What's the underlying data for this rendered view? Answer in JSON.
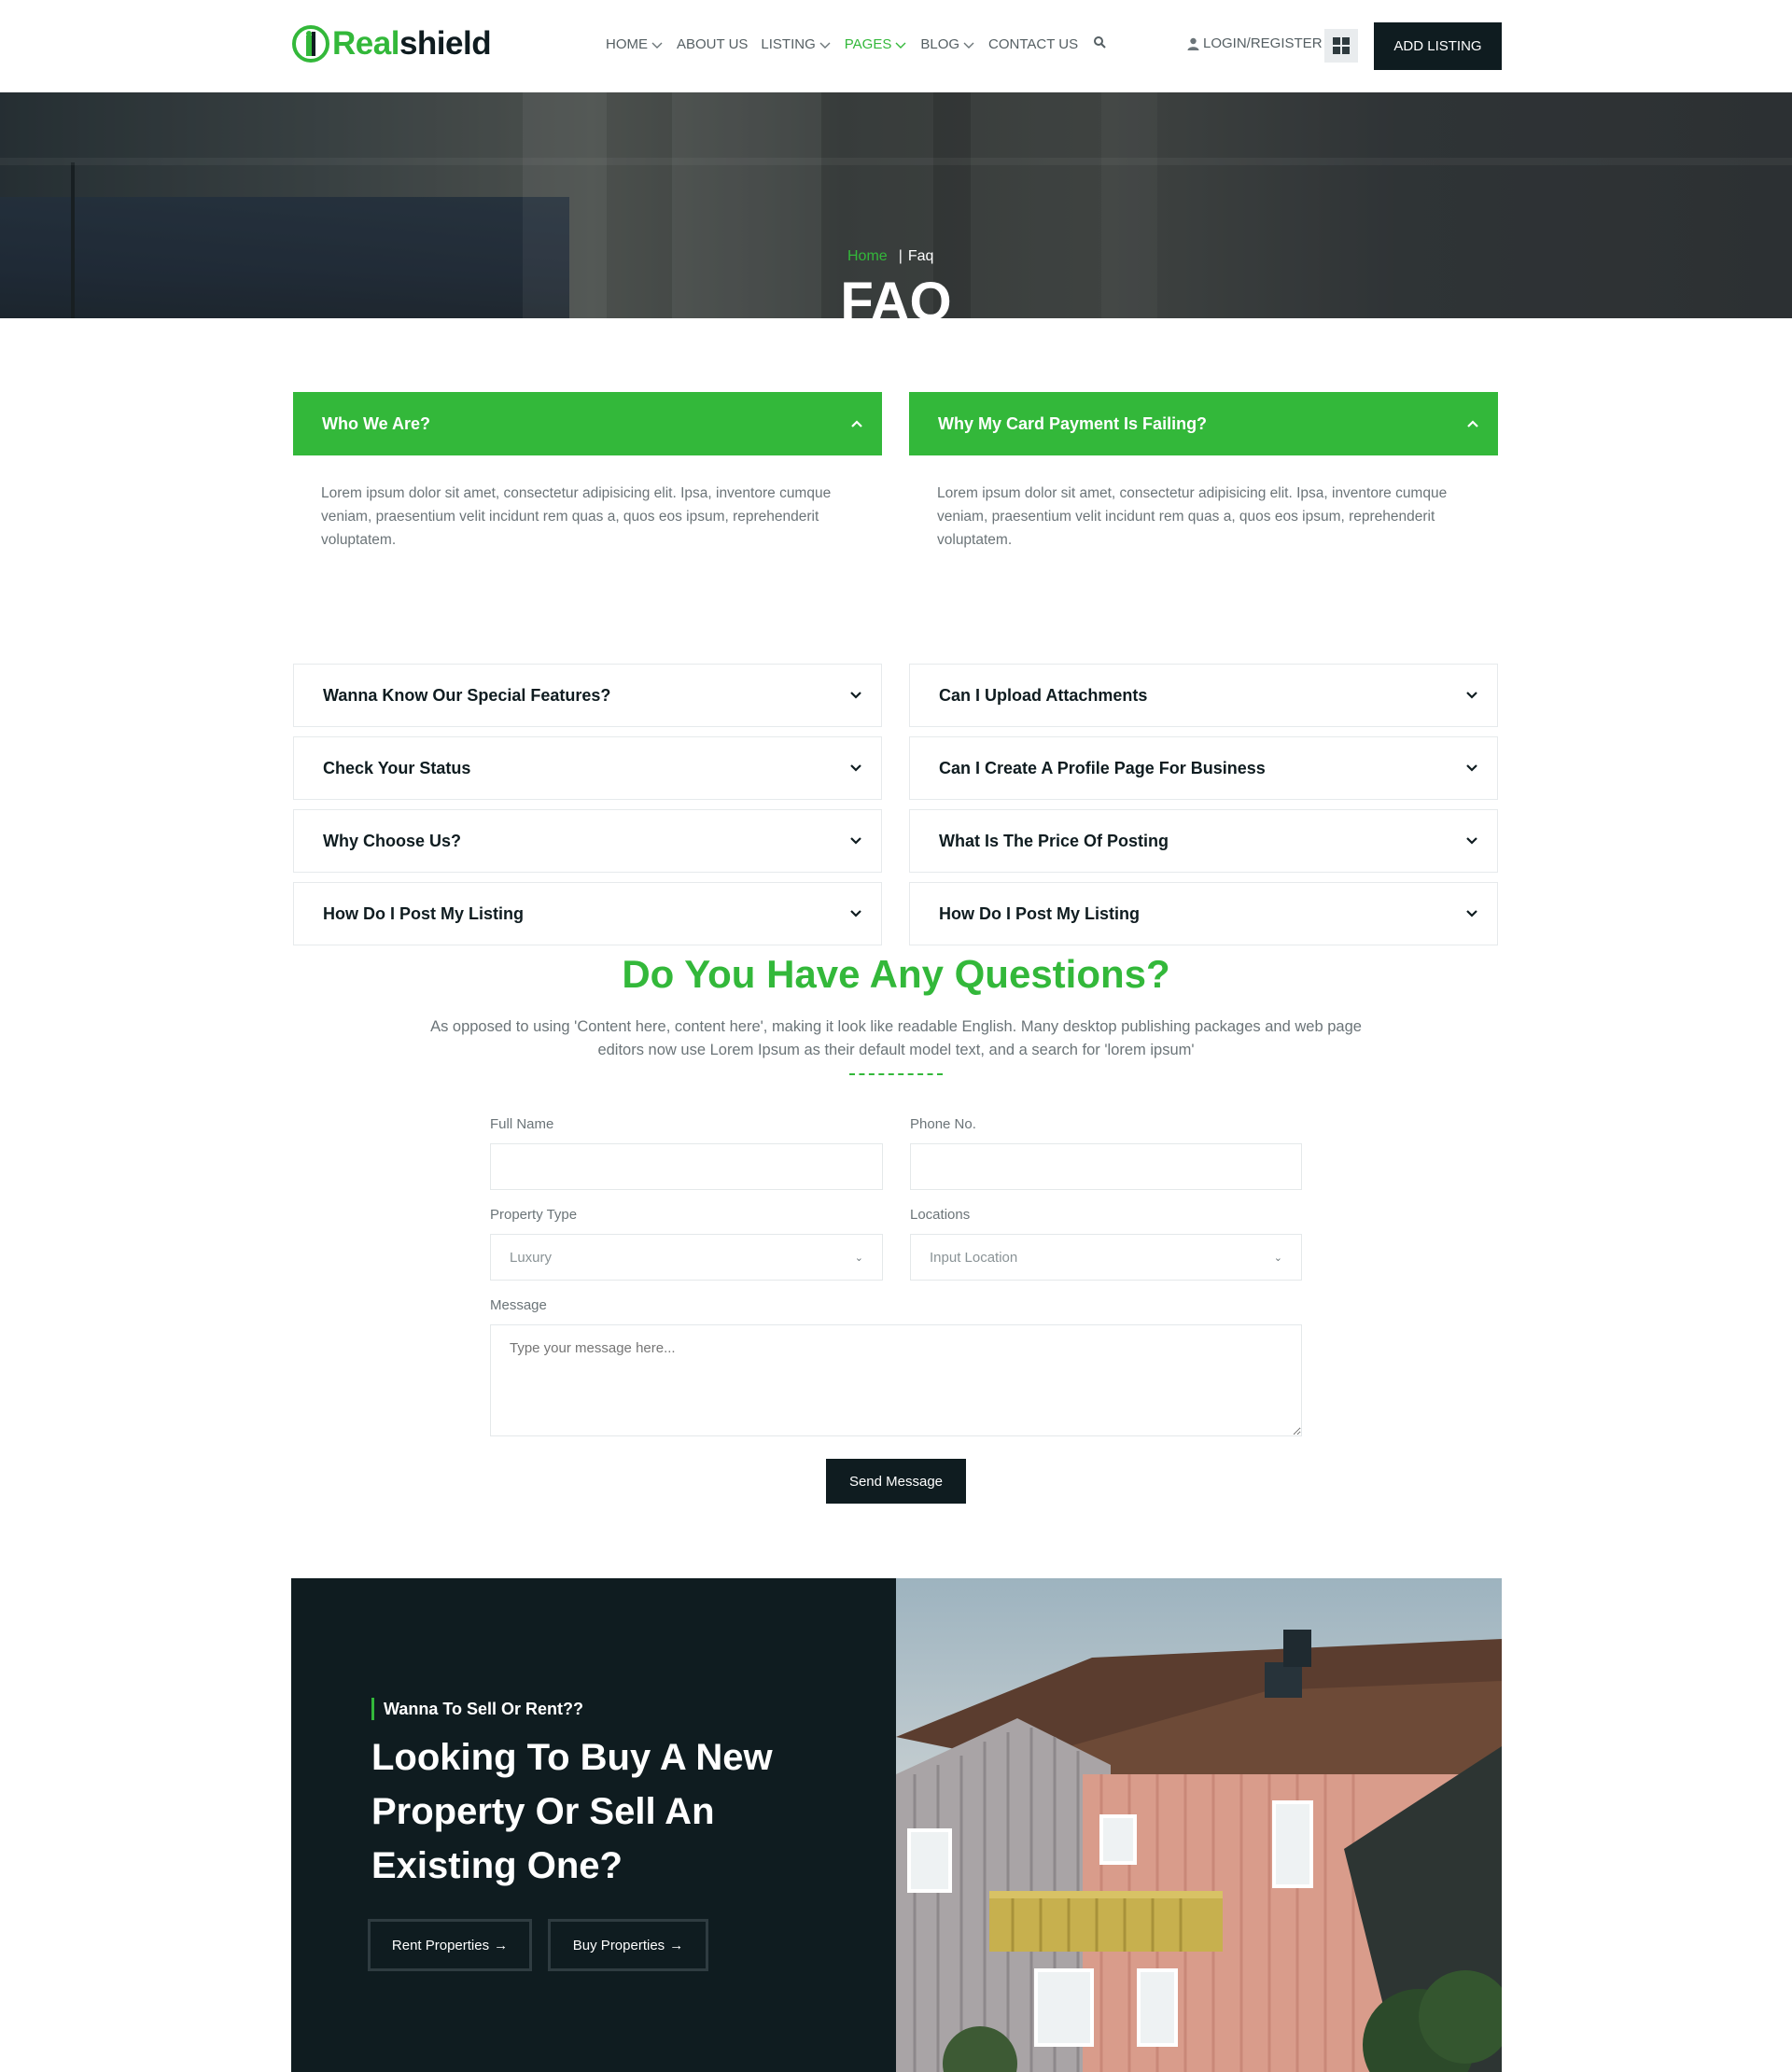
{
  "header": {
    "logo": {
      "part1": "Real",
      "part2": "shield"
    },
    "nav": [
      {
        "label": "HOME",
        "dropdown": true,
        "active": false
      },
      {
        "label": "ABOUT US",
        "dropdown": false,
        "active": false
      },
      {
        "label": "LISTING",
        "dropdown": true,
        "active": false
      },
      {
        "label": "PAGES",
        "dropdown": true,
        "active": true
      },
      {
        "label": "BLOG",
        "dropdown": true,
        "active": false
      },
      {
        "label": "CONTACT US",
        "dropdown": false,
        "active": false
      }
    ],
    "search_icon": "search-icon",
    "login_label": "LOGIN/REGISTER",
    "grid_icon": "grid-icon",
    "add_listing_label": "ADD LISTING"
  },
  "hero": {
    "breadcrumb_home": "Home",
    "breadcrumb_current": "Faq",
    "title": "FAQ"
  },
  "faq": {
    "left": {
      "open_question": "Who We Are?",
      "open_answer": "Lorem ipsum dolor sit amet, consectetur adipisicing elit. Ipsa, inventore cumque veniam, praesentium velit incidunt rem quas a, quos eos ipsum, reprehenderit voluptatem.",
      "items": [
        "Wanna Know Our Special Features?",
        "Check Your Status",
        "Why Choose Us?",
        "How Do I Post My Listing"
      ]
    },
    "right": {
      "open_question": "Why My Card Payment Is Failing?",
      "open_answer": "Lorem ipsum dolor sit amet, consectetur adipisicing elit. Ipsa, inventore cumque veniam, praesentium velit incidunt rem quas a, quos eos ipsum, reprehenderit voluptatem.",
      "items": [
        "Can I Upload Attachments",
        "Can I Create A Profile Page For Business",
        "What Is The Price Of Posting",
        "How Do I Post My Listing"
      ]
    }
  },
  "questions": {
    "title": "Do You Have Any Questions?",
    "subtitle": "As opposed to using 'Content here, content here', making it look like readable English. Many desktop publishing packages and web page editors now use Lorem Ipsum as their default model text, and a search for 'lorem ipsum'",
    "form": {
      "full_name_label": "Full Name",
      "full_name_value": "",
      "phone_label": "Phone No.",
      "phone_value": "",
      "property_type_label": "Property Type",
      "property_type_value": "Luxury",
      "locations_label": "Locations",
      "locations_value": "Input Location",
      "message_label": "Message",
      "message_placeholder": "Type your message here...",
      "send_label": "Send Message"
    }
  },
  "promo": {
    "kicker": "Wanna To Sell Or Rent??",
    "heading": "Looking To Buy A New Property Or Sell An Existing One?",
    "rent_label": "Rent Properties",
    "buy_label": "Buy Properties",
    "arrow_icon": "arrow-right-icon"
  },
  "colors": {
    "accent": "#33b83a",
    "dark": "#0f1c20",
    "muted_text": "#6b7478"
  }
}
